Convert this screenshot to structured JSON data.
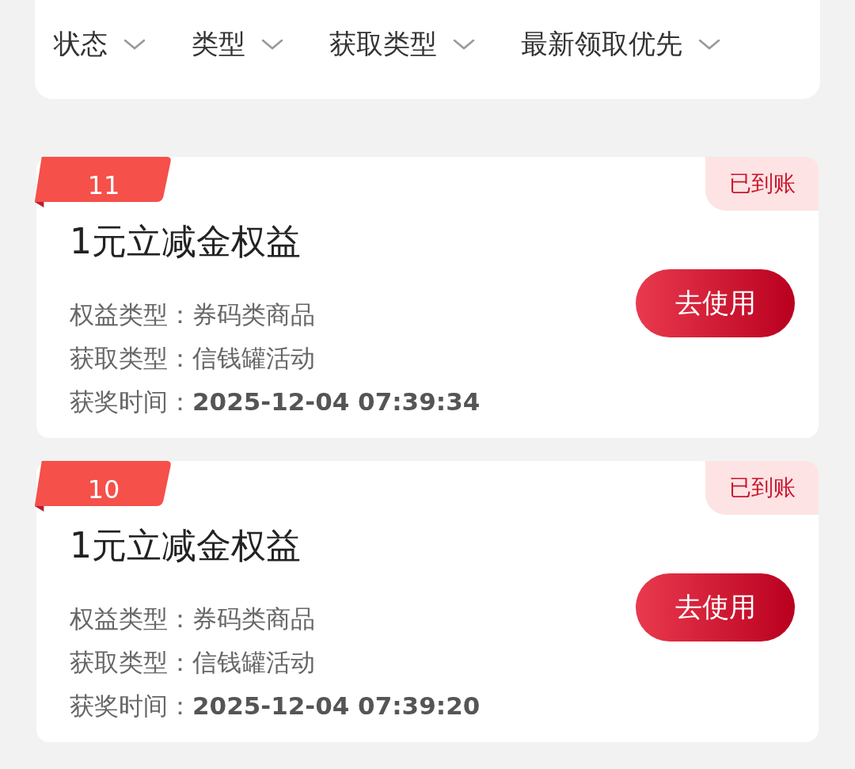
{
  "filters": [
    {
      "label": "状态"
    },
    {
      "label": "类型"
    },
    {
      "label": "获取类型"
    },
    {
      "label": "最新领取优先"
    }
  ],
  "records": [
    {
      "rank": "11",
      "status": "已到账",
      "title": "1元立减金权益",
      "action": "去使用",
      "fields": [
        {
          "kind": "text",
          "label": "权益类型：",
          "value": "券码类商品"
        },
        {
          "kind": "text",
          "label": "获取类型：",
          "value": "信钱罐活动"
        },
        {
          "kind": "datetime",
          "label": "获奖时间：",
          "value": "2025-12-04 07:39:34"
        }
      ]
    },
    {
      "rank": "10",
      "status": "已到账",
      "title": "1元立减金权益",
      "action": "去使用",
      "fields": [
        {
          "kind": "text",
          "label": "权益类型：",
          "value": "券码类商品"
        },
        {
          "kind": "text",
          "label": "获取类型：",
          "value": "信钱罐活动"
        },
        {
          "kind": "datetime",
          "label": "获奖时间：",
          "value": "2025-12-04 07:39:20"
        }
      ]
    }
  ]
}
